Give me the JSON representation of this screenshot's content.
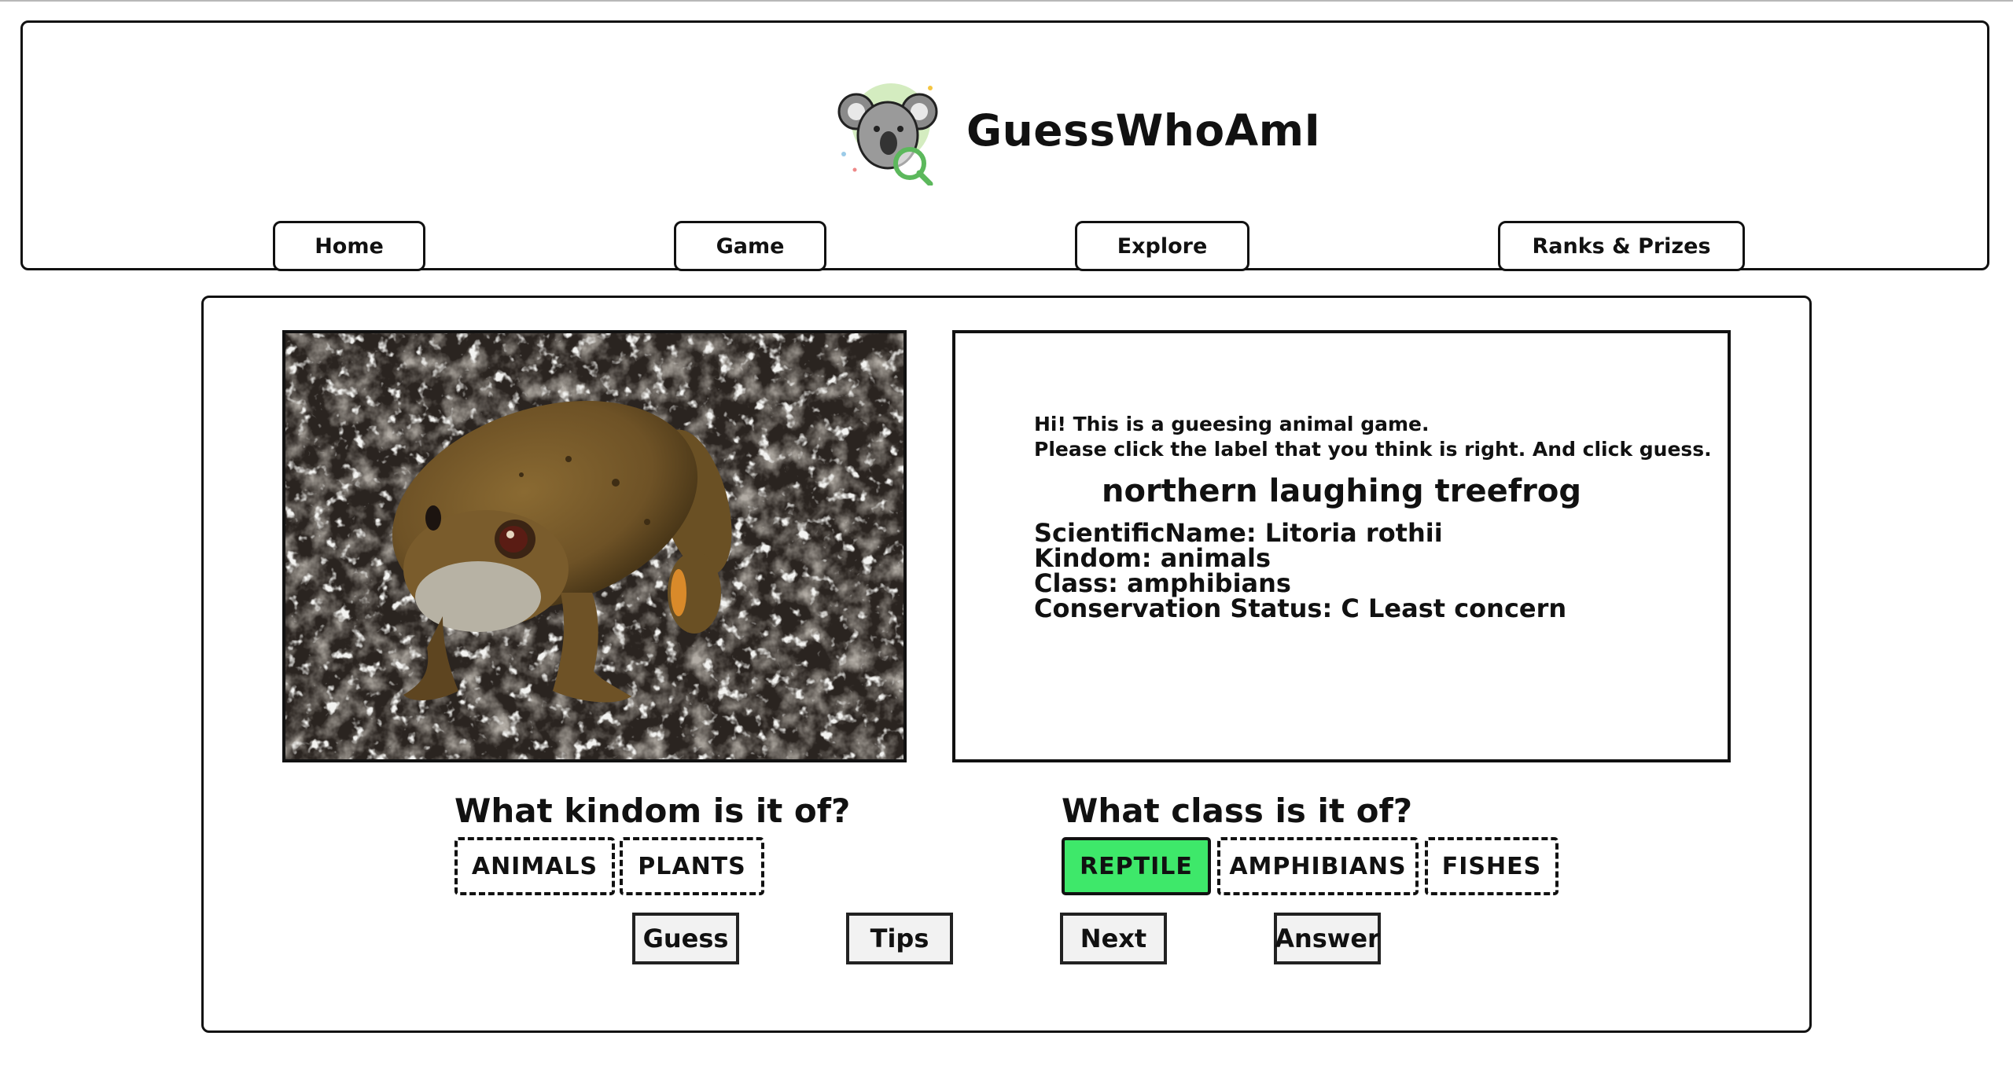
{
  "app": {
    "title": "GuessWhoAmI"
  },
  "nav": [
    {
      "label": "Home"
    },
    {
      "label": "Game"
    },
    {
      "label": "Explore"
    },
    {
      "label": "Ranks & Prizes"
    }
  ],
  "info": {
    "intro_line1": "Hi! This is a gueesing animal game.",
    "intro_line2": "Please click the label that you think is right. And click guess.",
    "animal_name": "northern laughing treefrog",
    "scientific_name": "ScientificName: Litoria rothii",
    "kingdom": "Kindom: animals",
    "class": "Class: amphibians",
    "conservation": "Conservation Status: C Least concern"
  },
  "kingdom_question": {
    "title": "What kindom is it of?",
    "options": [
      {
        "label": "ANIMALS",
        "selected": false
      },
      {
        "label": "PLANTS",
        "selected": false
      }
    ]
  },
  "class_question": {
    "title": "What class is it of?",
    "options": [
      {
        "label": "REPTILE",
        "selected": true
      },
      {
        "label": "AMPHIBIANS",
        "selected": false
      },
      {
        "label": "FISHES",
        "selected": false
      }
    ]
  },
  "actions": {
    "guess": "Guess",
    "tips": "Tips",
    "next": "Next",
    "answer": "Answer"
  },
  "colors": {
    "selected_option": "#3ee86a",
    "logo_accent": "#5cb85c"
  },
  "icons": {
    "logo": "koala-magnifier-icon",
    "photo": "frog-photo"
  }
}
